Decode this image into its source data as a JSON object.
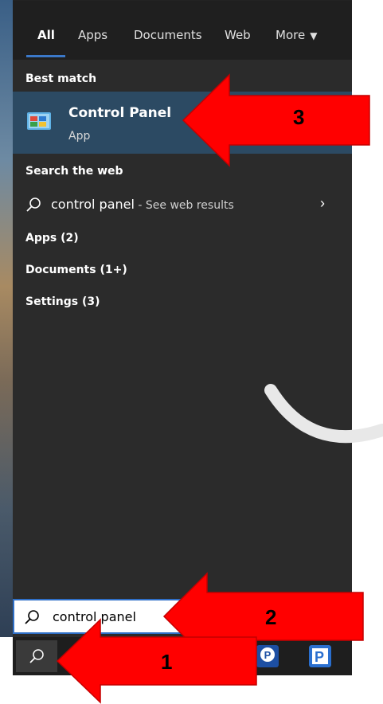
{
  "tabs": [
    {
      "label": "All",
      "active": true
    },
    {
      "label": "Apps"
    },
    {
      "label": "Documents"
    },
    {
      "label": "Web"
    },
    {
      "label": "More"
    }
  ],
  "best_match": {
    "section_label": "Best match",
    "title": "Control Panel",
    "subtitle": "App",
    "icon": "control-panel-icon"
  },
  "search_web": {
    "section_label": "Search the web",
    "query": "control panel",
    "suffix": " - See web results"
  },
  "categories": [
    "Apps (2)",
    "Documents (1+)",
    "Settings (3)"
  ],
  "search_box": {
    "value": "control panel"
  },
  "annotations": [
    "1",
    "2",
    "3"
  ],
  "colors": {
    "accent": "#3b78c8",
    "panel_bg": "#2b2b2b",
    "selected_bg": "#2c4a63",
    "arrow": "#ff0000"
  }
}
